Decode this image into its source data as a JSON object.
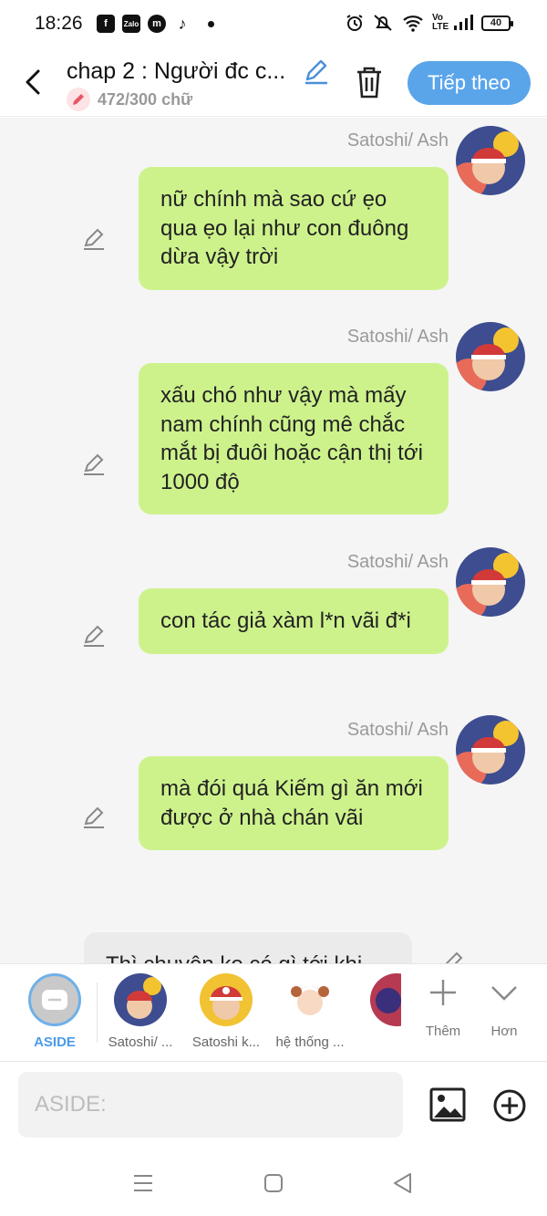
{
  "status_bar": {
    "time": "18:26",
    "app_icons": [
      "f",
      "Zalo",
      "m",
      "♪"
    ],
    "right_icons": [
      "alarm-icon",
      "mute-icon",
      "wifi-icon",
      "volte-icon",
      "signal-icon"
    ],
    "volte": "Vo LTE",
    "battery": "40"
  },
  "header": {
    "title": "chap 2 : Người đc c...",
    "word_count": "472/300 chữ",
    "next_label": "Tiếp theo"
  },
  "messages": [
    {
      "name": "Satoshi/ Ash",
      "text": "nữ chính mà sao cứ ẹo qua ẹo lại như con đuông dừa vậy trời"
    },
    {
      "name": "Satoshi/ Ash",
      "text": "xấu chó như vậy mà mấy nam chính cũng mê chắc mắt bị đuôi hoặc cận thị tới 1000 độ"
    },
    {
      "name": "Satoshi/ Ash",
      "text": "con tác giả xàm l*n vãi đ*i"
    },
    {
      "name": "Satoshi/ Ash",
      "text": "mà đói quá Kiếm gì ăn mới được ở nhà chán vãi"
    },
    {
      "text": "Thì chuyện ko có gì tới khi"
    }
  ],
  "characters": [
    {
      "label": "ASIDE"
    },
    {
      "label": "Satoshi/ ..."
    },
    {
      "label": "Satoshi k..."
    },
    {
      "label": "hệ thống ..."
    },
    {
      "label": ""
    }
  ],
  "actions": {
    "more_label": "Thêm",
    "expand_label": "Hơn"
  },
  "input": {
    "placeholder": "ASIDE:"
  },
  "colors": {
    "accent": "#5aa5ea",
    "bubble": "#cdf28c",
    "chat_bg": "#f5f5f5"
  }
}
